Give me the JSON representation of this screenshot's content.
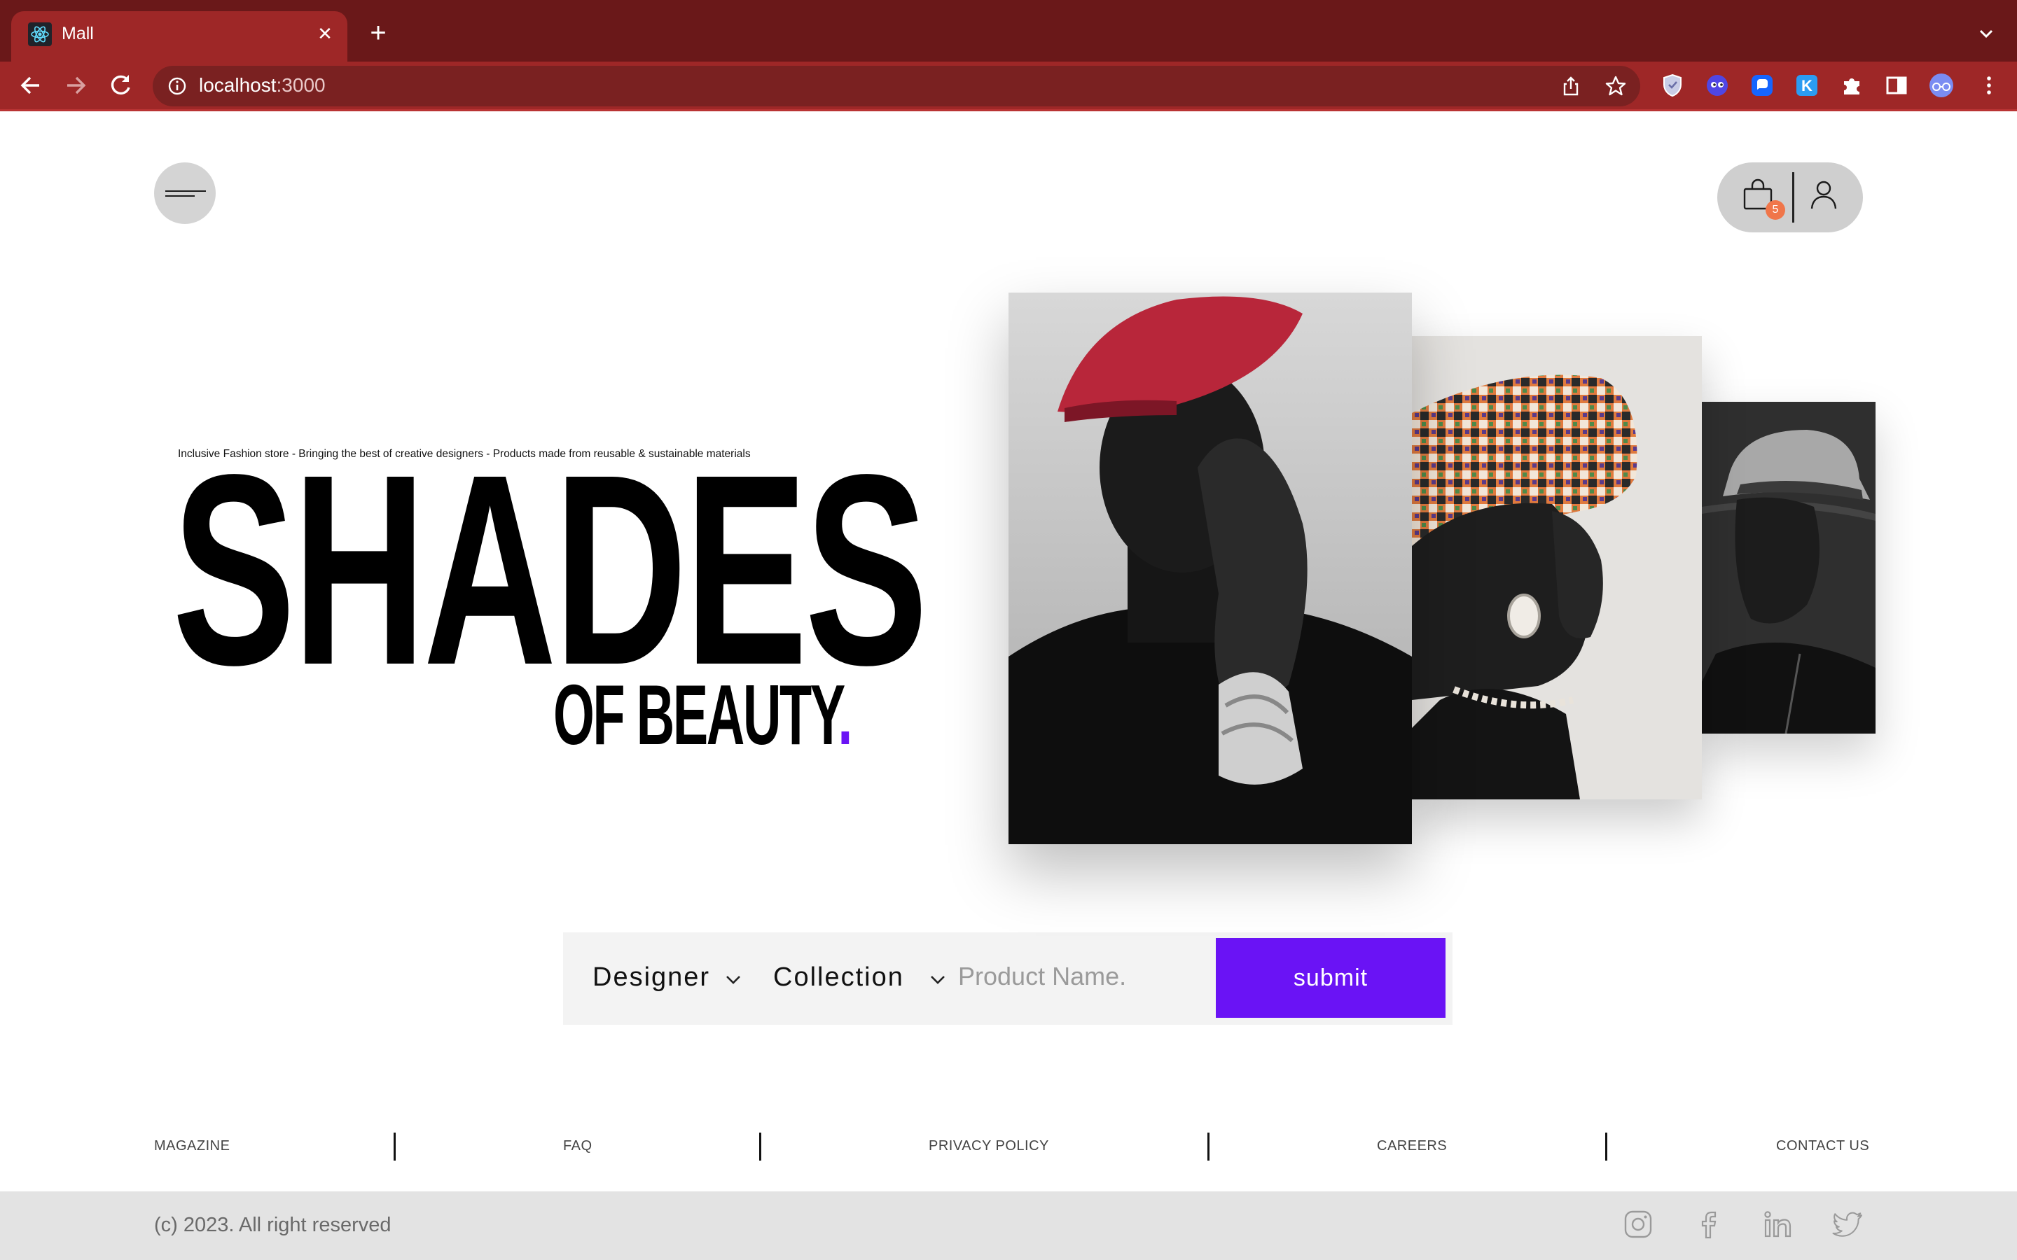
{
  "browser": {
    "tab_title": "Mall",
    "tab_close": "✕",
    "new_tab": "+",
    "url_host": "localhost",
    "url_port": ":3000"
  },
  "header": {
    "cart_count": "5"
  },
  "hero": {
    "tagline": "Inclusive Fashion store - Bringing the best of creative designers - Products made from reusable & sustainable materials",
    "title": "SHADES",
    "subtitle": "OF BEAUTY",
    "subtitle_dot": "."
  },
  "search": {
    "designer_label": "Designer",
    "collection_label": "Collection",
    "product_placeholder": "Product Name.",
    "submit_label": "submit"
  },
  "footer": {
    "links": [
      "MAGAZINE",
      "FAQ",
      "PRIVACY POLICY",
      "CAREERS",
      "CONTACT US"
    ],
    "copyright": "(c) 2023. All right reserved"
  },
  "social_icons": [
    "instagram-icon",
    "facebook-icon",
    "linkedin-icon",
    "twitter-icon"
  ],
  "colors": {
    "accent": "#6a13f5",
    "browser_frame": "#9e2727",
    "tab_strip": "#6a1819",
    "cart_badge": "#f0764a",
    "bottom_bar": "#e3e3e3"
  }
}
